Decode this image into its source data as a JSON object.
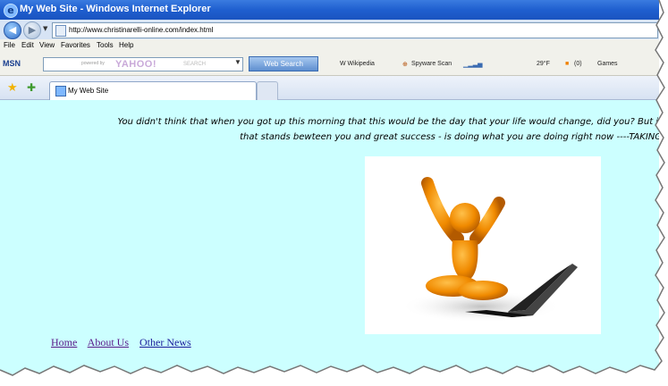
{
  "window": {
    "title": "My Web Site - Windows Internet Explorer"
  },
  "address": {
    "url": "http://www.christinarelli-online.com/index.html"
  },
  "menu": [
    "File",
    "Edit",
    "View",
    "Favorites",
    "Tools",
    "Help"
  ],
  "toolbar": {
    "msn": "MSN",
    "powered_by": "powered by",
    "yahoo": "YAHOO!",
    "search_word": "SEARCH",
    "web_search": "Web Search",
    "items": [
      "W Wikipedia",
      "Spyware Scan",
      "(0)",
      "29°F",
      "Games"
    ]
  },
  "tab": {
    "title": "My Web Site"
  },
  "page": {
    "intro_line1": "You didn't think that when you got up this morning that this would be the day that your life would change, did you?  But it",
    "intro_line2": "that stands bewteen you and great success - is doing what you are doing right now ----TAKING",
    "links": [
      "Home",
      "About Us",
      "Other News"
    ]
  },
  "colors": {
    "page_bg": "#ccffff",
    "title_bar": "#1f5fcf",
    "figure": "#ee8a00"
  }
}
